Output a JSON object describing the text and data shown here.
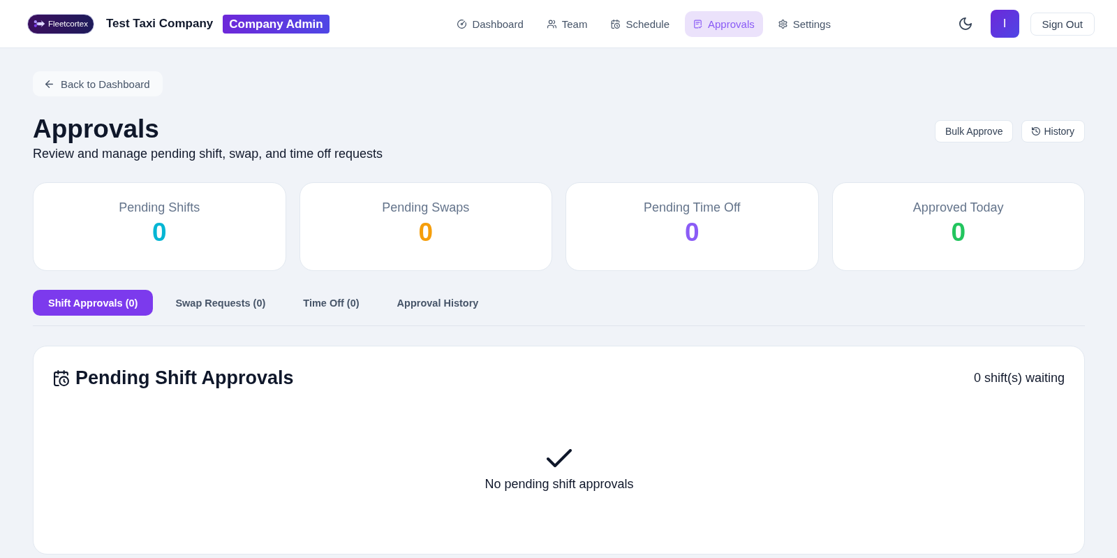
{
  "header": {
    "logo_text": "Fleetcortex",
    "company": "Test Taxi Company",
    "role_badge": "Company Admin",
    "nav": [
      {
        "label": "Dashboard",
        "selected": false
      },
      {
        "label": "Team",
        "selected": false
      },
      {
        "label": "Schedule",
        "selected": false
      },
      {
        "label": "Approvals",
        "selected": true
      },
      {
        "label": "Settings",
        "selected": false
      }
    ],
    "avatar": "I",
    "sign_out": "Sign Out"
  },
  "back_button": "Back to Dashboard",
  "page": {
    "title": "Approvals",
    "subtitle": "Review and manage pending shift, swap, and time off requests",
    "bulk_approve_button": "Bulk Approve",
    "history_button": "History"
  },
  "stats": [
    {
      "label": "Pending Shifts",
      "value": "0",
      "color": "#06b6d4"
    },
    {
      "label": "Pending Swaps",
      "value": "0",
      "color": "#f59e0b"
    },
    {
      "label": "Pending Time Off",
      "value": "0",
      "color": "#8b5cf6"
    },
    {
      "label": "Approved Today",
      "value": "0",
      "color": "#22c55e"
    }
  ],
  "tabs": [
    {
      "label": "Shift Approvals (0)",
      "selected": true
    },
    {
      "label": "Swap Requests (0)",
      "selected": false
    },
    {
      "label": "Time Off (0)",
      "selected": false
    },
    {
      "label": "Approval History",
      "selected": false
    }
  ],
  "panel": {
    "title": "Pending Shift Approvals",
    "count": "0 shift(s) waiting",
    "empty_message": "No pending shift approvals"
  }
}
